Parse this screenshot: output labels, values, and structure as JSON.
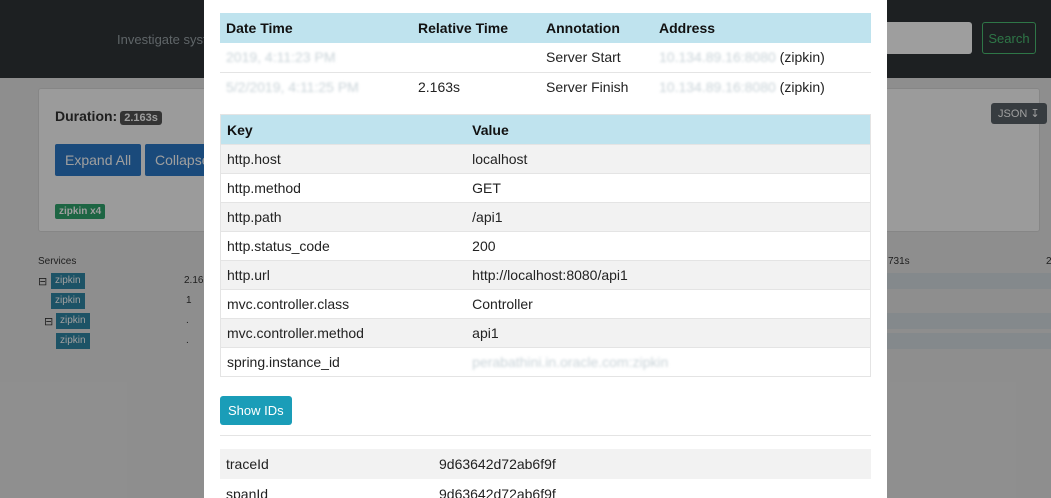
{
  "background": {
    "nav_text": "Investigate syste",
    "search_button": "Search",
    "duration_label": "Duration:",
    "duration_value": "2.163s",
    "expand_all": "Expand All",
    "collapse_all": "Collapse",
    "service_tag": "zipkin x4",
    "json_button": "JSON",
    "services_label": "Services",
    "scale_label_1": "731s",
    "scale_label_2": "2",
    "rows": [
      {
        "service": "zipkin",
        "num": "2.16"
      },
      {
        "service": "zipkin",
        "num": "1"
      },
      {
        "service": "zipkin",
        "num": "."
      },
      {
        "service": "zipkin",
        "num": "."
      }
    ]
  },
  "annotations": {
    "headers": [
      "Date Time",
      "Relative Time",
      "Annotation",
      "Address"
    ],
    "rows": [
      {
        "date_time": "2019, 4:11:23 PM",
        "relative_time": "",
        "annotation": "Server Start",
        "address": "10.134.89.16:8080",
        "service": "(zipkin)"
      },
      {
        "date_time": "5/2/2019, 4:11:25 PM",
        "relative_time": "2.163s",
        "annotation": "Server Finish",
        "address": "10.134.89.16:8080",
        "service": "(zipkin)"
      }
    ]
  },
  "tags": {
    "headers": [
      "Key",
      "Value"
    ],
    "rows": [
      {
        "key": "http.host",
        "value": "localhost"
      },
      {
        "key": "http.method",
        "value": "GET"
      },
      {
        "key": "http.path",
        "value": "/api1"
      },
      {
        "key": "http.status_code",
        "value": "200"
      },
      {
        "key": "http.url",
        "value": "http://localhost:8080/api1"
      },
      {
        "key": "mvc.controller.class",
        "value": "Controller"
      },
      {
        "key": "mvc.controller.method",
        "value": "api1"
      },
      {
        "key": "spring.instance_id",
        "value": "perabathini.in.oracle.com:zipkin"
      }
    ]
  },
  "show_ids_label": "Show IDs",
  "ids": {
    "rows": [
      {
        "key": "traceId",
        "value": "9d63642d72ab6f9f"
      },
      {
        "key": "spanId",
        "value": "9d63642d72ab6f9f"
      }
    ]
  }
}
